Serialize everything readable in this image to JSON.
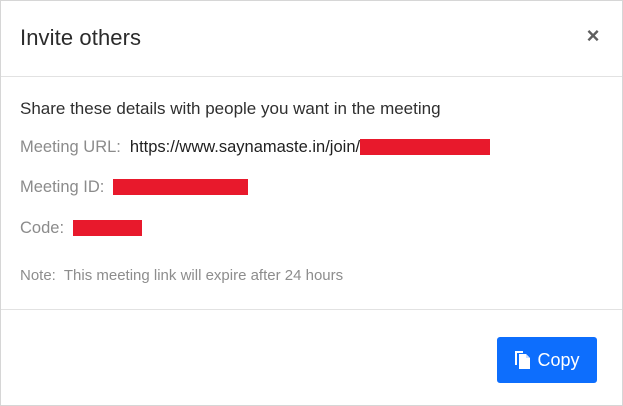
{
  "dialog": {
    "title": "Invite others",
    "close_glyph": "×",
    "close_icon": "close-icon"
  },
  "details": {
    "intro": "Share these details with people you want in the meeting",
    "meeting_url_label": "Meeting URL:",
    "meeting_url_value": "https://www.saynamaste.in/join/",
    "meeting_id_label": "Meeting ID:",
    "code_label": "Code:",
    "redaction_color": "#e8192c"
  },
  "note": {
    "label": "Note:",
    "text": "This meeting link will expire after 24 hours"
  },
  "footer": {
    "copy_label": "Copy",
    "copy_icon": "copy-icon",
    "accent_color": "#0d6efd"
  }
}
